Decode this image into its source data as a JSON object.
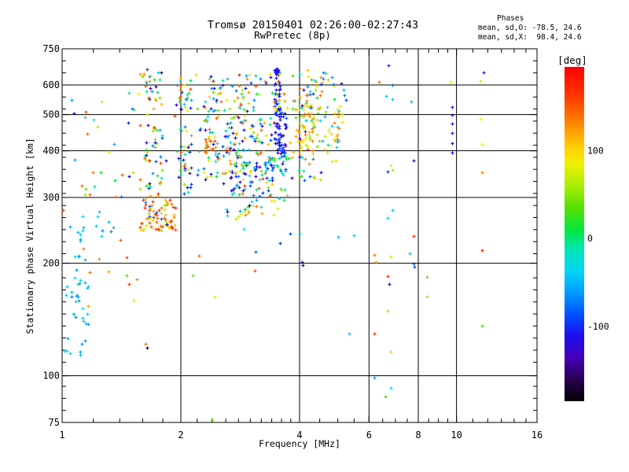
{
  "colors": {
    "background": "#ffffff",
    "axis": "#000000",
    "text": "#000000"
  },
  "chart_data": {
    "type": "scatter",
    "title": "Tromsø 20150401 02:26:00-02:27:43",
    "subtitle": "RwPretec (8p)",
    "stats": {
      "heading": "Phases",
      "line_o": "mean, sd,O: -78.5, 24.6",
      "line_x": "mean, sd,X:  98.4, 24.6"
    },
    "xlabel": "Frequency [MHz]",
    "ylabel": "Stationary phase Virtual Height [km]",
    "x_scale": "log",
    "y_scale": "log",
    "xlim": [
      1,
      16
    ],
    "ylim": [
      75,
      750
    ],
    "x_ticks": [
      1,
      2,
      4,
      6,
      8,
      10,
      16
    ],
    "x_minor_ticks": [
      1.2,
      1.4,
      1.6,
      1.8,
      2.2,
      2.4,
      2.6,
      2.8,
      3,
      3.2,
      3.4,
      3.6,
      3.8,
      4.5,
      5,
      5.5,
      6.5,
      7,
      7.5,
      8.5,
      9,
      9.5,
      11,
      12,
      13,
      14,
      15
    ],
    "y_ticks": [
      75,
      100,
      200,
      300,
      400,
      500,
      600,
      750
    ],
    "y_minor_divisions": 31,
    "grid_x": [
      2,
      4,
      6,
      8,
      10
    ],
    "grid_y": [
      100,
      200,
      300,
      400,
      500,
      600
    ],
    "grid": true,
    "marker": "plus",
    "colorbar": {
      "label": "[deg]",
      "ticks": [
        100,
        0,
        -100
      ],
      "vmin": -185,
      "vmax": 195,
      "colormap": [
        [
          -185,
          "#000000"
        ],
        [
          -160,
          "#2a0050"
        ],
        [
          -135,
          "#4400bb"
        ],
        [
          -110,
          "#1a10ee"
        ],
        [
          -85,
          "#0055ff"
        ],
        [
          -60,
          "#00a0ff"
        ],
        [
          -35,
          "#00d8f0"
        ],
        [
          -12,
          "#00e6b4"
        ],
        [
          8,
          "#00e646"
        ],
        [
          35,
          "#55e000"
        ],
        [
          60,
          "#aaee00"
        ],
        [
          85,
          "#f0f000"
        ],
        [
          105,
          "#ffcc00"
        ],
        [
          130,
          "#ff8800"
        ],
        [
          160,
          "#ff3c00"
        ],
        [
          195,
          "#ff0000"
        ]
      ]
    },
    "points": [
      [
        1.005,
        278,
        155
      ],
      [
        1.26,
        542,
        70
      ],
      [
        1.15,
        508,
        150
      ],
      [
        1.12,
        322,
        140
      ],
      [
        1.63,
        122,
        140
      ],
      [
        1.645,
        119,
        -170
      ],
      [
        1.24,
        206,
        130
      ],
      [
        1.13,
        219,
        135
      ],
      [
        1.46,
        208,
        155
      ],
      [
        1.46,
        186,
        35
      ],
      [
        1.55,
        181,
        135
      ],
      [
        1.52,
        159,
        95
      ],
      [
        1.48,
        176,
        160
      ],
      [
        2.14,
        186,
        40
      ],
      [
        2.22,
        210,
        140
      ],
      [
        2.44,
        163,
        95
      ],
      [
        2.4,
        76,
        45
      ],
      [
        2.62,
        269,
        -35
      ],
      [
        2.76,
        263,
        60
      ],
      [
        2.8,
        267,
        70
      ],
      [
        2.84,
        271,
        75
      ],
      [
        2.88,
        275,
        80
      ],
      [
        2.92,
        279,
        40
      ],
      [
        2.96,
        283,
        15
      ],
      [
        2.98,
        286,
        -170
      ],
      [
        3.78,
        240,
        -90
      ],
      [
        2.89,
        247,
        -30
      ],
      [
        4.0,
        240,
        -45
      ],
      [
        5.5,
        238,
        -40
      ],
      [
        3.56,
        227,
        -95
      ],
      [
        3.1,
        215,
        -80
      ],
      [
        4.05,
        202,
        -140
      ],
      [
        4.07,
        198,
        -145
      ],
      [
        3.08,
        191,
        150
      ],
      [
        5.34,
        130,
        -40
      ],
      [
        6.2,
        130,
        165
      ],
      [
        6.8,
        116,
        110
      ],
      [
        6.2,
        99,
        -60
      ],
      [
        6.6,
        88,
        30
      ],
      [
        6.8,
        93,
        -35
      ],
      [
        8.4,
        184,
        130
      ],
      [
        8.4,
        163,
        55
      ],
      [
        6.7,
        185,
        165
      ],
      [
        6.74,
        176,
        -140
      ],
      [
        6.7,
        149,
        60
      ],
      [
        11.6,
        136,
        35
      ],
      [
        11.6,
        217,
        170
      ],
      [
        6.2,
        211,
        135
      ],
      [
        6.25,
        202,
        120
      ],
      [
        6.8,
        209,
        95
      ],
      [
        7.6,
        213,
        -40
      ],
      [
        7.8,
        200,
        -85
      ],
      [
        7.82,
        196,
        -85
      ],
      [
        7.8,
        237,
        175
      ],
      [
        5.0,
        236,
        -45
      ],
      [
        11.6,
        350,
        130
      ],
      [
        11.6,
        417,
        85
      ],
      [
        11.5,
        487,
        90
      ],
      [
        7.8,
        376,
        -135
      ],
      [
        6.82,
        366,
        95
      ],
      [
        6.86,
        355,
        60
      ],
      [
        6.7,
        352,
        -95
      ],
      [
        6.86,
        277,
        -40
      ],
      [
        6.7,
        264,
        -35
      ],
      [
        6.36,
        612,
        140
      ],
      [
        6.73,
        676,
        -100
      ],
      [
        11.7,
        647,
        -105
      ],
      [
        11.5,
        616,
        75
      ],
      [
        6.86,
        600,
        -80
      ],
      [
        6.63,
        560,
        -40
      ],
      [
        6.86,
        551,
        -40
      ],
      [
        7.66,
        542,
        -45
      ],
      [
        9.66,
        613,
        85
      ],
      [
        9.75,
        395,
        -110
      ],
      [
        9.75,
        420,
        -112
      ],
      [
        9.75,
        447,
        -108
      ],
      [
        9.75,
        474,
        -110
      ],
      [
        9.75,
        500,
        -112
      ],
      [
        9.75,
        525,
        -108
      ],
      [
        1.61,
        642,
        130
      ],
      [
        1.64,
        660,
        -90
      ],
      [
        1.78,
        650,
        -160
      ]
    ],
    "point_clusters": {
      "format": [
        "count",
        "f_min",
        "f_max",
        "h_min",
        "h_max",
        "deg_min",
        "deg_max",
        "seed"
      ],
      "list": [
        [
          40,
          1.01,
          1.17,
          110,
          235,
          -70,
          -20,
          11
        ],
        [
          14,
          1.03,
          1.35,
          235,
          300,
          -70,
          -20,
          12
        ],
        [
          4,
          1.15,
          1.45,
          150,
          290,
          120,
          155,
          13
        ],
        [
          14,
          1.05,
          1.55,
          300,
          430,
          -130,
          160,
          14
        ],
        [
          8,
          1.05,
          1.5,
          430,
          600,
          -120,
          160,
          15
        ],
        [
          55,
          1.55,
          1.95,
          243,
          298,
          100,
          175,
          16
        ],
        [
          12,
          1.55,
          1.95,
          243,
          298,
          35,
          95,
          17
        ],
        [
          6,
          1.6,
          1.95,
          245,
          295,
          -120,
          -50,
          18
        ],
        [
          55,
          1.62,
          1.8,
          300,
          655,
          -140,
          170,
          19
        ],
        [
          55,
          1.95,
          2.13,
          300,
          630,
          -140,
          170,
          20
        ],
        [
          40,
          2.28,
          2.5,
          330,
          655,
          -140,
          170,
          21
        ],
        [
          18,
          2.3,
          2.48,
          395,
          440,
          110,
          170,
          22
        ],
        [
          40,
          1.5,
          2.6,
          300,
          650,
          -140,
          170,
          23
        ],
        [
          60,
          3.45,
          3.58,
          400,
          675,
          -130,
          -85,
          24
        ],
        [
          35,
          3.5,
          3.72,
          385,
          520,
          -135,
          -75,
          25
        ],
        [
          25,
          3.35,
          3.75,
          345,
          395,
          -120,
          40,
          26
        ],
        [
          95,
          2.55,
          3.45,
          310,
          500,
          -140,
          -15,
          27
        ],
        [
          65,
          2.55,
          3.45,
          310,
          500,
          -10,
          170,
          28
        ],
        [
          70,
          2.5,
          4.4,
          500,
          662,
          -140,
          170,
          29
        ],
        [
          45,
          3.95,
          4.35,
          380,
          560,
          45,
          140,
          30
        ],
        [
          30,
          4.4,
          5.15,
          390,
          530,
          25,
          135,
          31
        ],
        [
          12,
          4.35,
          5.1,
          395,
          525,
          -65,
          0,
          32
        ],
        [
          40,
          3.78,
          4.35,
          330,
          570,
          -140,
          170,
          33
        ],
        [
          35,
          2.6,
          3.7,
          268,
          318,
          -130,
          160,
          34
        ],
        [
          18,
          4.4,
          5.3,
          545,
          650,
          -130,
          150,
          35
        ],
        [
          30,
          2.2,
          5.0,
          300,
          660,
          -140,
          170,
          36
        ]
      ]
    }
  }
}
